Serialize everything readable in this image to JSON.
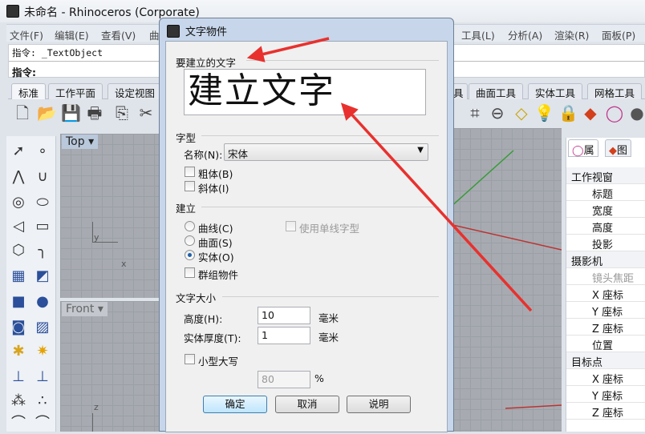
{
  "window": {
    "title": "未命名 - Rhinoceros (Corporate)"
  },
  "menu": [
    "文件(F)",
    "编辑(E)",
    "查看(V)",
    "曲",
    "工具(L)",
    "分析(A)",
    "渲染(R)",
    "面板(P)"
  ],
  "command": {
    "history": "指令: _TextObject",
    "prompt": "指令:"
  },
  "tabs": [
    "标准",
    "工作平面",
    "设定视图",
    "具",
    "曲面工具",
    "实体工具",
    "网格工具"
  ],
  "viewports": {
    "top": "Top",
    "front": "Front",
    "axis_y": "y",
    "axis_x": "x",
    "axis_z": "z"
  },
  "panel": {
    "tabs": [
      "属",
      "图"
    ],
    "rows": [
      {
        "t": "工作视窗",
        "k": "h"
      },
      {
        "t": "标题",
        "k": "i"
      },
      {
        "t": "宽度",
        "k": "i"
      },
      {
        "t": "高度",
        "k": "i"
      },
      {
        "t": "投影",
        "k": "i"
      },
      {
        "t": "摄影机",
        "k": "h"
      },
      {
        "t": "镜头焦距",
        "k": "i dis"
      },
      {
        "t": "X 座标",
        "k": "i"
      },
      {
        "t": "Y 座标",
        "k": "i"
      },
      {
        "t": "Z 座标",
        "k": "i"
      },
      {
        "t": "位置",
        "k": "i"
      },
      {
        "t": "目标点",
        "k": "h"
      },
      {
        "t": "X 座标",
        "k": "i"
      },
      {
        "t": "Y 座标",
        "k": "i"
      },
      {
        "t": "Z 座标",
        "k": "i"
      }
    ]
  },
  "dialog": {
    "title": "文字物件",
    "text_label": "要建立的文字",
    "text_value": "建立文字",
    "font_group": "字型",
    "font_name_label": "名称(N):",
    "font_name_value": "宋体",
    "bold": {
      "label": "粗体(B)",
      "checked": false
    },
    "italic": {
      "label": "斜体(I)",
      "checked": false
    },
    "create_group": "建立",
    "curve": "曲线(C)",
    "surface": "曲面(S)",
    "solid": "实体(O)",
    "selected": "solid",
    "single_stroke": "使用单线字型",
    "group_objects": "群组物件",
    "size_group": "文字大小",
    "height_label": "高度(H):",
    "height_value": "10",
    "height_unit": "毫米",
    "thickness_label": "实体厚度(T):",
    "thickness_value": "1",
    "thickness_unit": "毫米",
    "small_caps": "小型大写",
    "small_caps_value": "80",
    "percent": "%",
    "ok": "确定",
    "cancel": "取消",
    "help": "说明"
  },
  "annotation_color": "#e8312e"
}
